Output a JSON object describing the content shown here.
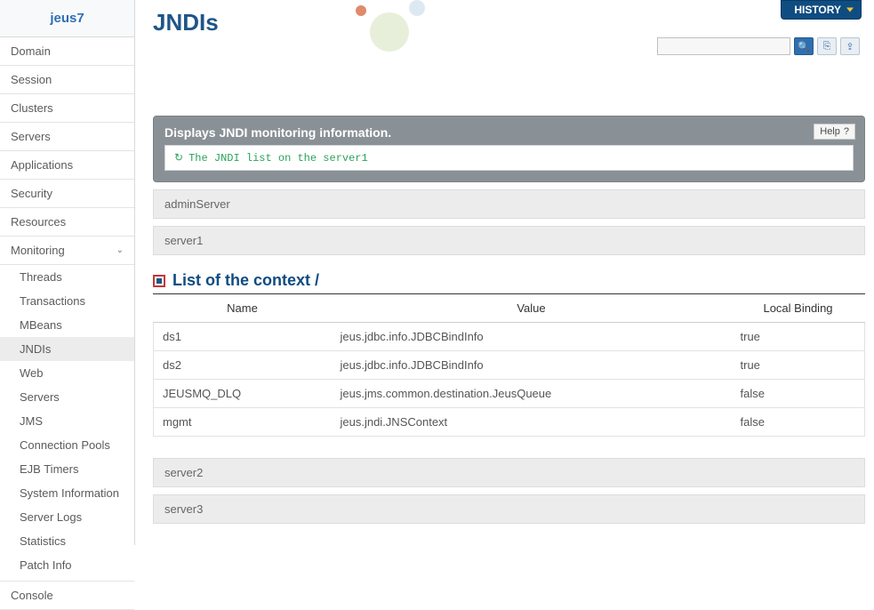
{
  "app_title": "jeus7",
  "sidebar": {
    "sections": [
      "Domain",
      "Session",
      "Clusters",
      "Servers",
      "Applications",
      "Security",
      "Resources",
      "Monitoring"
    ],
    "monitoring_items": [
      "Threads",
      "Transactions",
      "MBeans",
      "JNDIs",
      "Web",
      "Servers",
      "JMS",
      "Connection Pools",
      "EJB Timers",
      "System Information",
      "Server Logs",
      "Statistics",
      "Patch Info"
    ],
    "active_sub": "JNDIs",
    "console": "Console"
  },
  "header": {
    "history": "HISTORY",
    "search_placeholder": ""
  },
  "page_title": "JNDIs",
  "banner": {
    "title": "Displays JNDI monitoring information.",
    "help": "Help",
    "message": "The JNDI list on the server1"
  },
  "servers_top": [
    "adminServer",
    "server1"
  ],
  "context": {
    "heading": "List of the context /",
    "columns": [
      "Name",
      "Value",
      "Local Binding"
    ],
    "rows": [
      {
        "name": "ds1",
        "value": "jeus.jdbc.info.JDBCBindInfo",
        "binding": "true"
      },
      {
        "name": "ds2",
        "value": "jeus.jdbc.info.JDBCBindInfo",
        "binding": "true"
      },
      {
        "name": "JEUSMQ_DLQ",
        "value": "jeus.jms.common.destination.JeusQueue",
        "binding": "false"
      },
      {
        "name": "mgmt",
        "value": "jeus.jndi.JNSContext",
        "binding": "false"
      }
    ]
  },
  "servers_bottom": [
    "server2",
    "server3"
  ]
}
